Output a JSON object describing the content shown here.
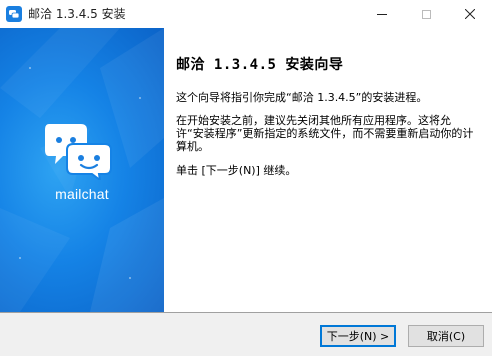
{
  "window": {
    "title": "邮洽 1.3.4.5 安装",
    "minimize_icon": "minimize-icon",
    "maximize_icon": "maximize-icon",
    "close_icon": "close-icon"
  },
  "banner": {
    "brand_name": "mailchat",
    "logo_icon": "mailchat-bubbles-icon",
    "background_color": "#1583e6"
  },
  "content": {
    "heading": "邮洽 1.3.4.5 安装向导",
    "paragraph1": "这个向导将指引你完成“邮洽 1.3.4.5”的安装进程。",
    "paragraph2": "在开始安装之前，建议先关闭其他所有应用程序。这将允许“安装程序”更新指定的系统文件，而不需要重新启动你的计算机。",
    "paragraph3": "单击 [下一步(N)] 继续。"
  },
  "footer": {
    "next_label": "下一步(N) >",
    "cancel_label": "取消(C)"
  }
}
